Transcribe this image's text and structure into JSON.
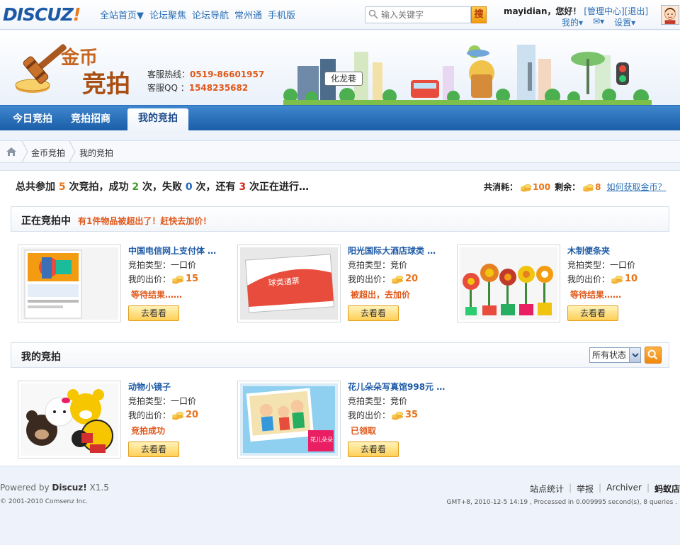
{
  "topbar": {
    "logo": "DISCUZ",
    "logo_bang": "!",
    "nav": [
      "全站首页▼",
      "论坛聚焦",
      "论坛导航",
      "常州通",
      "手机版"
    ],
    "search_placeholder": "输入关键字",
    "search_button": "搜",
    "username": "mayidian",
    "greeting": "，您好！",
    "admin_link": "[管理中心]",
    "logout_link": "[退出]",
    "my_menu": "我的▾",
    "msg_menu": "✉▾",
    "settings_menu": "设置▾"
  },
  "banner": {
    "brand_top": "金币",
    "brand_bottom": "竞拍",
    "hotline_label": "客服热线：",
    "hotline_value": "0519-86601957",
    "qq_label": "客服QQ ：",
    "qq_value": "1548235682",
    "sign": "化龙巷"
  },
  "nav": {
    "tabs": [
      "今日竞拍",
      "竞拍招商",
      "我的竞拍"
    ],
    "active": "我的竞拍"
  },
  "breadcrumb": [
    "金币竞拍",
    "我的竞拍"
  ],
  "summary": {
    "p1": "总共参加",
    "total": "5",
    "p2": "次竞拍，成功",
    "success": "2",
    "p3": "次，失败",
    "fail": "0",
    "p4": "次，还有",
    "ongoing": "3",
    "p5": "次正在进行…"
  },
  "coins": {
    "spent_label": "共消耗：",
    "spent": "100",
    "left_label": "剩余：",
    "left": "8",
    "how_link": "如何获取金币？"
  },
  "ongoing_section": {
    "title": "正在竞拍中",
    "warning": "有1件物品被超出了！赶快去加价！",
    "items": [
      {
        "title": "中国电信网上支付体 …",
        "type_label": "竞拍类型：",
        "type": "一口价",
        "bid_label": "我的出价：",
        "bid": "15",
        "status": "等待结果……",
        "button": "去看看"
      },
      {
        "title": "阳光国际大酒店球类 …",
        "type_label": "竞拍类型：",
        "type": "竞价",
        "bid_label": "我的出价：",
        "bid": "20",
        "status": "被超出，去加价",
        "button": "去看看"
      },
      {
        "title": "木制便条夹",
        "type_label": "竞拍类型：",
        "type": "一口价",
        "bid_label": "我的出价：",
        "bid": "10",
        "status": "等待结果……",
        "button": "去看看"
      }
    ]
  },
  "my_section": {
    "title": "我的竞拍",
    "filter": "所有状态",
    "items": [
      {
        "title": "动物小镜子",
        "type_label": "竞拍类型：",
        "type": "一口价",
        "bid_label": "我的出价：",
        "bid": "20",
        "status": "竞拍成功",
        "button": "去看看"
      },
      {
        "title": "花儿朵朵写真馆998元 …",
        "type_label": "竞拍类型：",
        "type": "竞价",
        "bid_label": "我的出价：",
        "bid": "35",
        "status": "已领取",
        "button": "去看看"
      }
    ]
  },
  "footer": {
    "powered_prefix": "Powered by ",
    "powered_brand": "Discuz!",
    "powered_version": " X1.5",
    "copyright": "© 2001-2010 Comsenz Inc.",
    "links": [
      "站点统计",
      "举报",
      "Archiver"
    ],
    "site_name": "蚂蚁店",
    "gmt": "GMT+8, 2010-12-5 14:19 , Processed in 0.009995 second(s), 8 queries ."
  }
}
